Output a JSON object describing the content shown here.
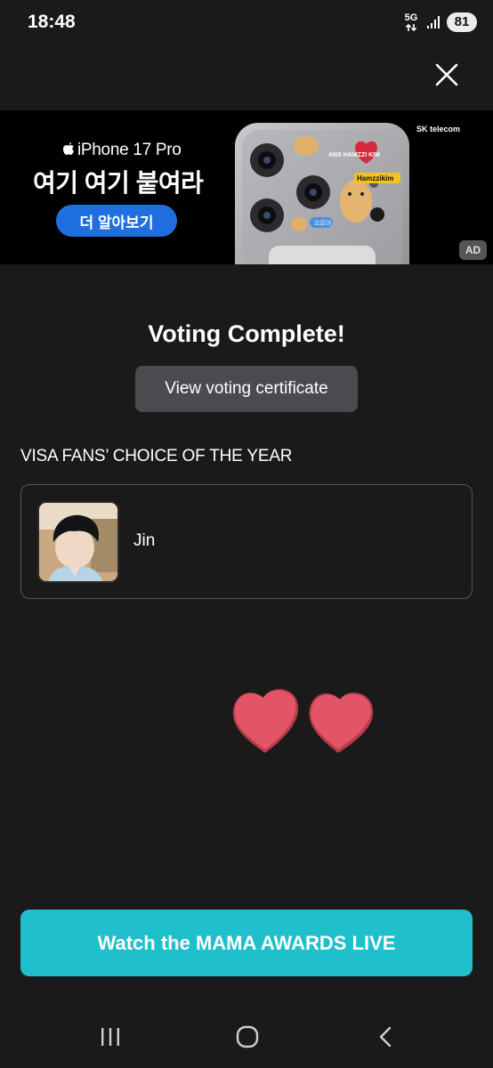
{
  "status_bar": {
    "time": "18:48",
    "network": "5G",
    "battery": "81"
  },
  "ad": {
    "brand": "iPhone 17 Pro",
    "headline": "여기 여기 붙여라",
    "cta_label": "더 알아보기",
    "telecom": "SK telecom",
    "ad_label": "AD",
    "sticker_text": "ANX HAMZZI KIM",
    "sticker_tag": "Hamzzikim",
    "sticker_bubble": "으르이"
  },
  "main": {
    "title": "Voting Complete!",
    "certificate_button": "View voting certificate",
    "category": "VISA FANS’ CHOICE OF THE YEAR",
    "nominee": {
      "name": "Jin"
    },
    "cta_label": "Watch the MAMA AWARDS LIVE"
  },
  "colors": {
    "background": "#1a1a1b",
    "cta": "#1fbfcc",
    "heart": "#e25566",
    "ad_button": "#1f6fe0"
  },
  "icons": {
    "close": "close-icon",
    "recent_apps": "recent-apps-icon",
    "home": "home-icon",
    "back": "back-icon"
  }
}
